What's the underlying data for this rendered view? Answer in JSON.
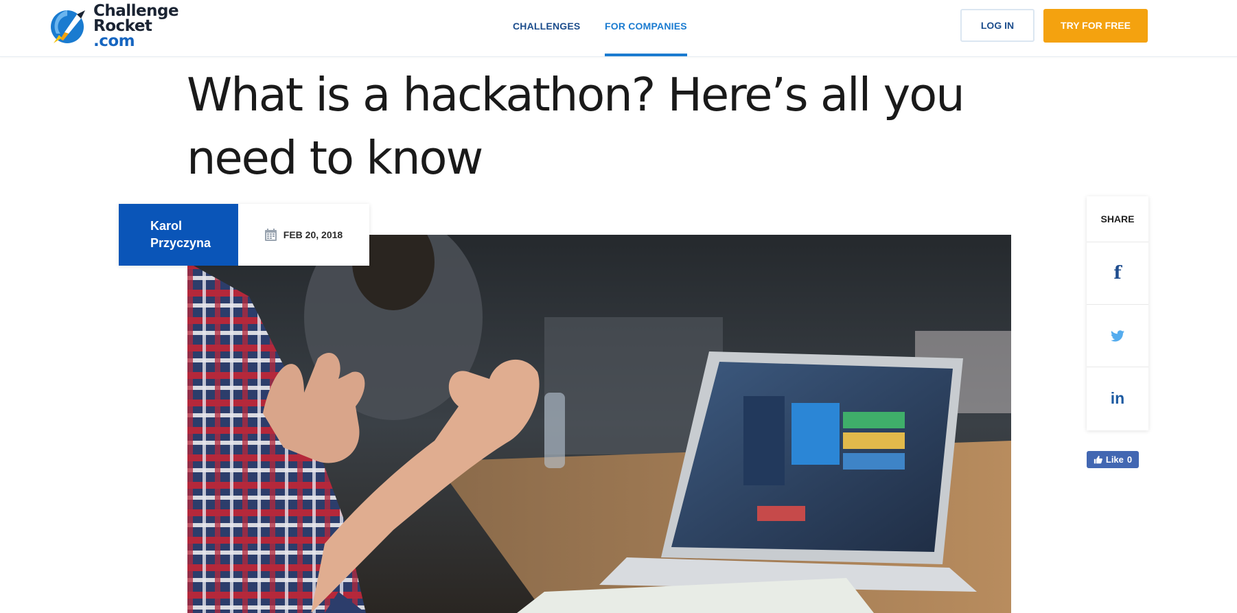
{
  "header": {
    "logo": {
      "line1": "Challenge",
      "line2": "Rocket",
      "line3": ".com"
    },
    "nav": [
      {
        "label": "CHALLENGES",
        "active": false
      },
      {
        "label": "FOR COMPANIES",
        "active": true
      }
    ],
    "login_label": "LOG IN",
    "try_label": "TRY FOR FREE"
  },
  "article": {
    "title": "What is a hackathon? Here’s all you need to know",
    "author": "Karol Przyczyna",
    "date": "FEB 20, 2018"
  },
  "share": {
    "heading": "SHARE",
    "networks": [
      "facebook-icon",
      "twitter-icon",
      "linkedin-icon"
    ],
    "facebook_glyph": "f",
    "linkedin_glyph": "in",
    "like_label": "Like",
    "like_count": "0"
  },
  "colors": {
    "brand_blue": "#0a55b8",
    "nav_active": "#1a7bd0",
    "cta_orange": "#f4a20f",
    "facebook_blue": "#4267b2",
    "twitter_blue": "#55acee"
  }
}
